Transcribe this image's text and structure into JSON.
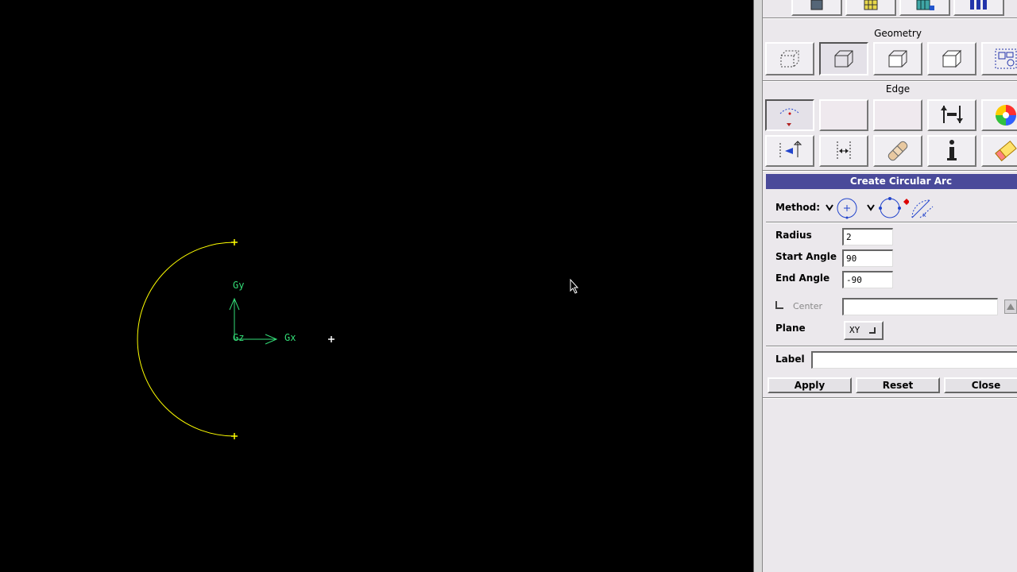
{
  "viewport": {
    "axes": {
      "x_label": "Gx",
      "y_label": "Gy",
      "z_label": "Gz"
    },
    "colors": {
      "arc": "#ffff00",
      "axis": "#33dd77",
      "background": "#000000"
    }
  },
  "panel": {
    "geometry_label": "Geometry",
    "edge_label": "Edge",
    "form": {
      "title": "Create Circular Arc",
      "method_label": "Method:",
      "radius_label": "Radius",
      "radius_value": "2",
      "start_angle_label": "Start Angle",
      "start_angle_value": "90",
      "end_angle_label": "End Angle",
      "end_angle_value": "-90",
      "center_label": "Center",
      "center_value": "",
      "plane_label": "Plane",
      "plane_value": "XY",
      "label_label": "Label",
      "label_value": "",
      "apply_label": "Apply",
      "reset_label": "Reset",
      "close_label": "Close"
    }
  }
}
